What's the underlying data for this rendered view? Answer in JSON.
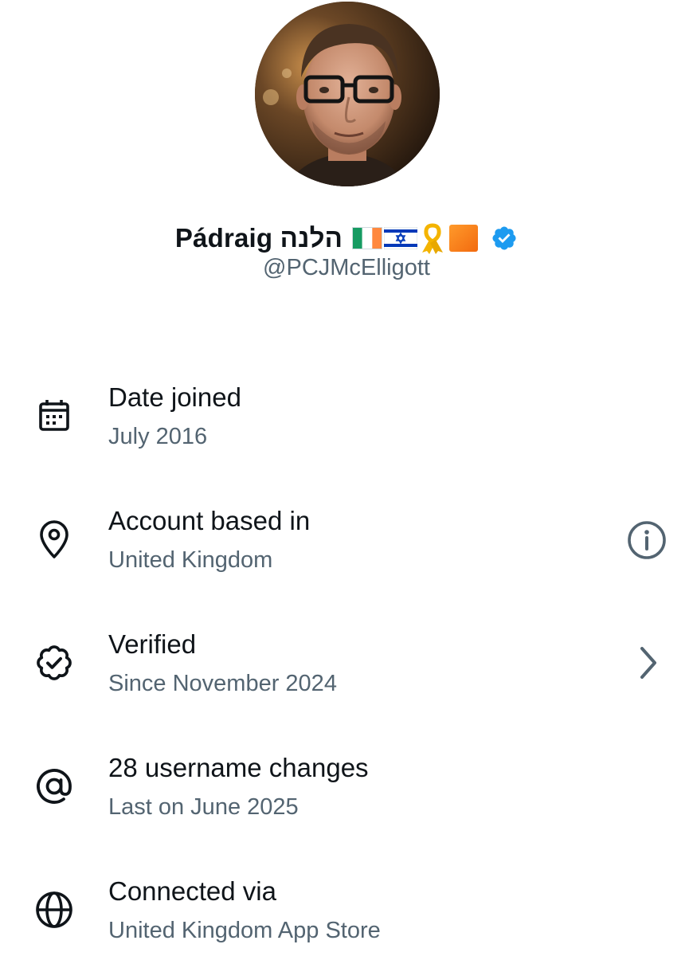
{
  "profile": {
    "display_name": "Pádraig הלנה",
    "handle": "@PCJMcElligott",
    "name_emoji_icons": [
      "ireland-flag-icon",
      "israel-flag-icon",
      "yellow-ribbon-icon",
      "orange-square-icon"
    ],
    "verified_icon": "verified-badge-icon",
    "avatar_icon": "profile-photo"
  },
  "rows": [
    {
      "icon": "calendar-icon",
      "title": "Date joined",
      "subtitle": "July 2016",
      "action": null
    },
    {
      "icon": "location-pin-icon",
      "title": "Account based in",
      "subtitle": "United Kingdom",
      "action": "info-icon"
    },
    {
      "icon": "verified-outline-icon",
      "title": "Verified",
      "subtitle": "Since November 2024",
      "action": "chevron-right-icon"
    },
    {
      "icon": "at-sign-icon",
      "title": "28 username changes",
      "subtitle": "Last on June 2025",
      "action": null
    },
    {
      "icon": "globe-icon",
      "title": "Connected via",
      "subtitle": "United Kingdom App Store",
      "action": null
    }
  ],
  "colors": {
    "text_primary": "#0f1419",
    "text_secondary": "#536471",
    "verified_blue": "#1d9bf0",
    "background": "#ffffff"
  }
}
